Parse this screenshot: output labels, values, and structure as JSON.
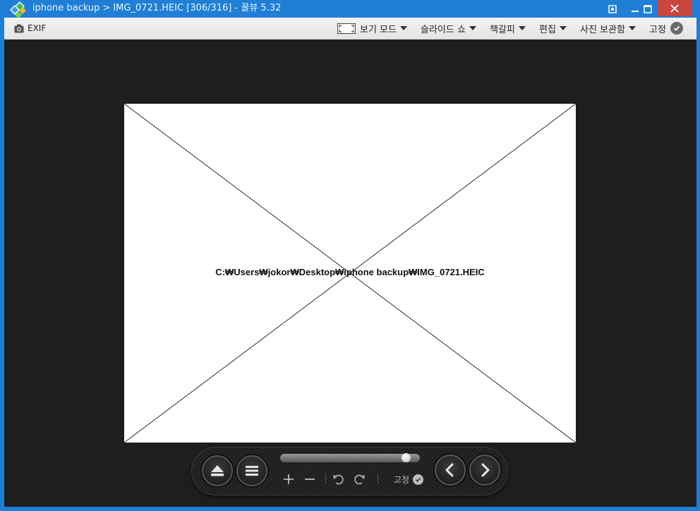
{
  "window": {
    "title_folder": "iphone backup",
    "title_separator": ">",
    "title_file": "IMG_0721.HEIC",
    "title_counter": "[306/316]",
    "title_dash": "-",
    "title_app": "꿀뷰 5.32"
  },
  "toolbar": {
    "exif_label": "EXIF",
    "view_mode_label": "보기 모드",
    "slideshow_label": "슬라이드 쇼",
    "bookmark_label": "책갈피",
    "edit_label": "편집",
    "album_label": "사진 보관함",
    "pin_label": "고정"
  },
  "viewer": {
    "image_path": "C:₩Users₩jokor₩Desktop₩iphone backup₩IMG_0721.HEIC"
  },
  "controls": {
    "pin_label": "고정",
    "zoom_level": 0.93
  },
  "colors": {
    "titlebar": "#1f7fd6",
    "close_button": "#c9463f",
    "viewer_background": "#1e1e1e"
  },
  "icons": {
    "app": "honeyview-logo-icon",
    "exif": "camera-icon",
    "view_mode": "fullscreen-icon",
    "eject": "eject-icon",
    "menu": "hamburger-menu-icon",
    "prev": "chevron-left-icon",
    "next": "chevron-right-icon"
  }
}
